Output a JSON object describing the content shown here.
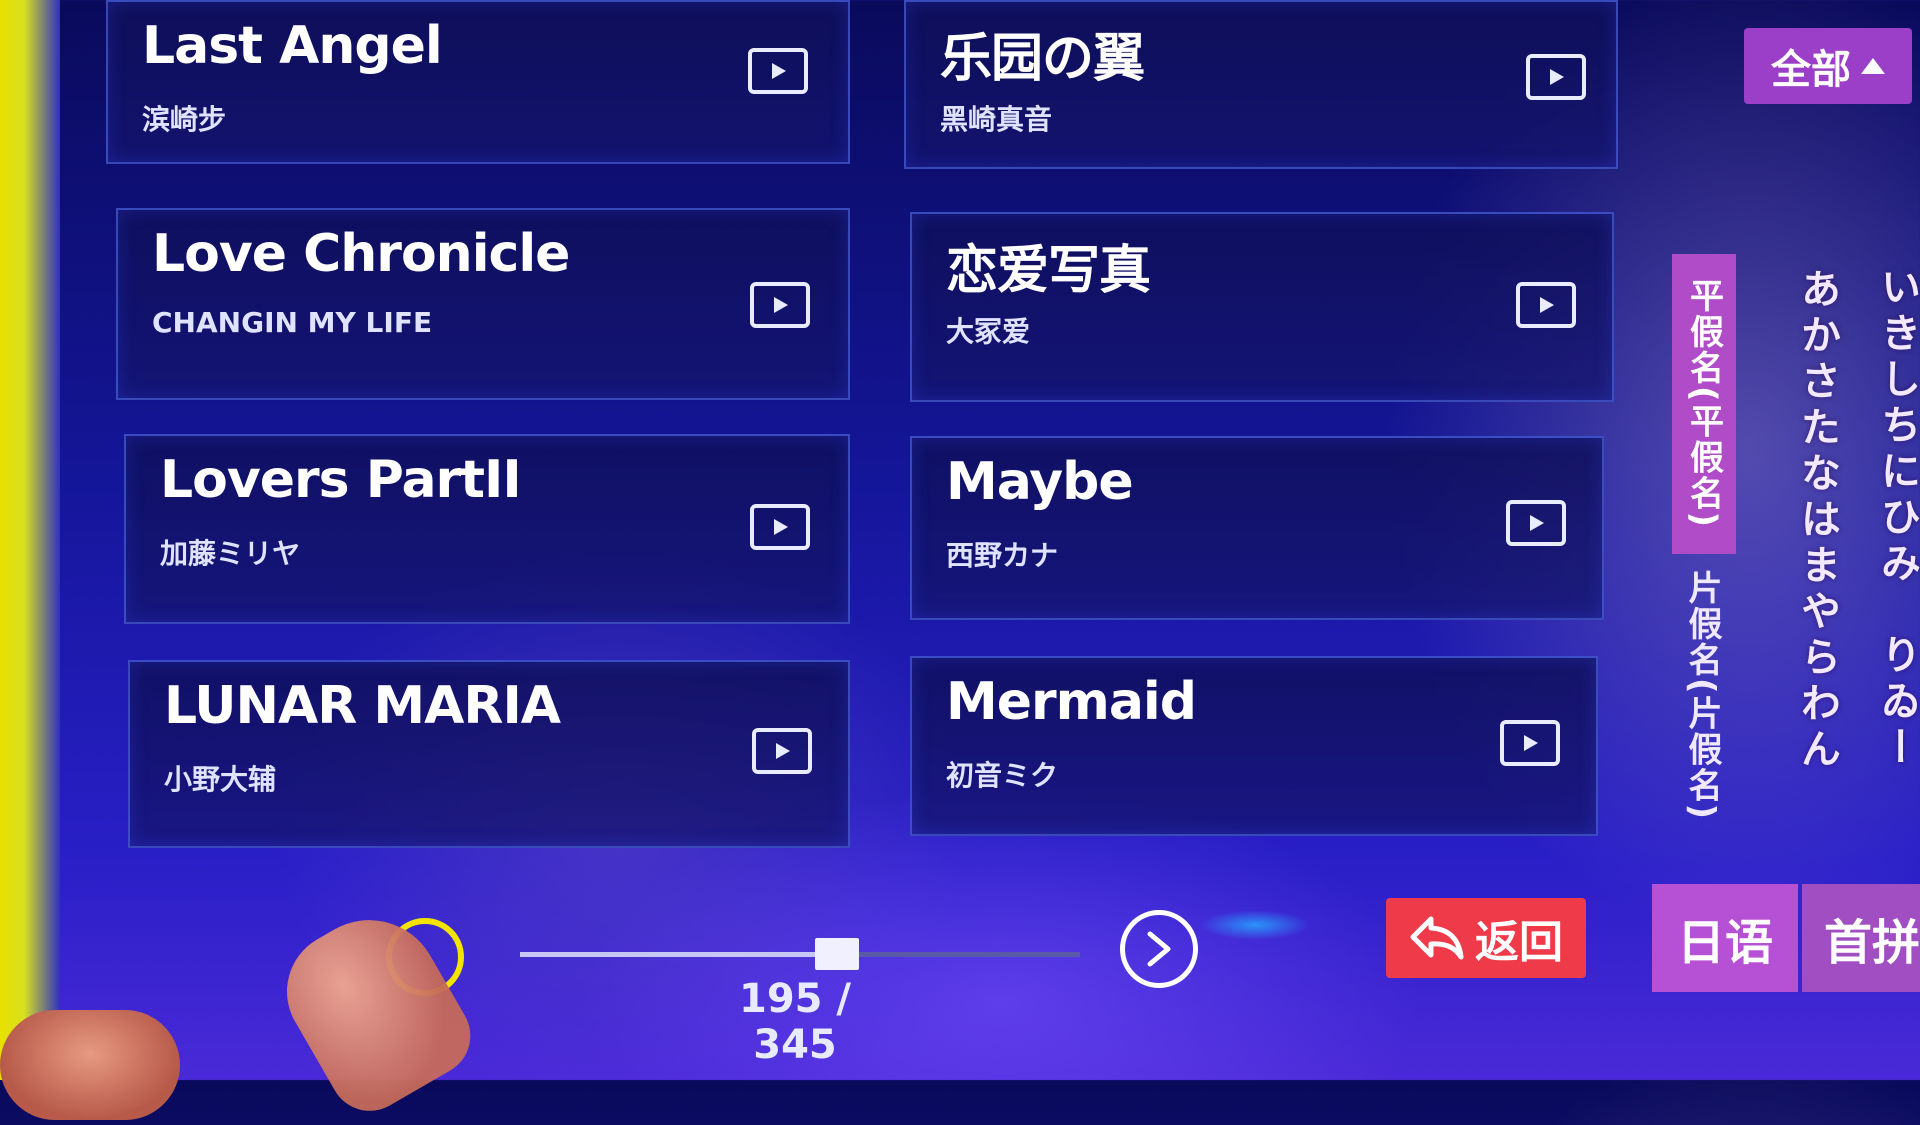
{
  "filter": {
    "label": "全部"
  },
  "songs": [
    {
      "title": "Last Angel",
      "artist": "滨崎步"
    },
    {
      "title": "乐园の翼",
      "artist": "黑崎真音"
    },
    {
      "title": "Love Chronicle",
      "artist": "CHANGIN MY LIFE"
    },
    {
      "title": "恋爱写真",
      "artist": "大冢爱"
    },
    {
      "title": "Lovers PartII",
      "artist": "加藤ミリヤ"
    },
    {
      "title": "Maybe",
      "artist": "西野カナ"
    },
    {
      "title": "LUNAR MARIA",
      "artist": "小野大辅"
    },
    {
      "title": "Mermaid",
      "artist": "初音ミク"
    }
  ],
  "kana_panel": {
    "hiragana_tab": "平假名(平假名)",
    "katakana_tab": "片假名(片假名)",
    "col1": "あかさたなはまやらわん",
    "col2": "いきしちにひみ　りゐー"
  },
  "lang_tabs": {
    "japanese": "日语",
    "initial_pinyin": "首拼"
  },
  "back_button": {
    "label": "返回"
  },
  "pagination": {
    "label": "195 / 345",
    "current": 195,
    "total": 345
  },
  "icons": {
    "play": "play-icon",
    "next": "chevron-right-icon",
    "back": "reply-arrow-icon"
  },
  "colors": {
    "accent_purple": "#9b3fc8",
    "back_red": "#ef3a4a",
    "card_border": "#5a78ff"
  }
}
